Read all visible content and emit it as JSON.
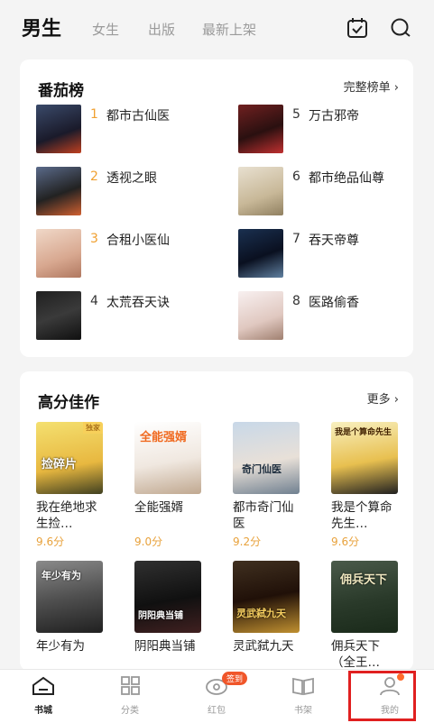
{
  "header": {
    "active_tab": "男生",
    "tabs": [
      "女生",
      "出版",
      "最新上架"
    ],
    "icons": [
      "calendar-check-icon",
      "search-icon"
    ]
  },
  "ranking": {
    "title": "番茄榜",
    "link": "完整榜单 ›",
    "items": [
      {
        "num": "1",
        "title": "都市古仙医"
      },
      {
        "num": "2",
        "title": "透视之眼"
      },
      {
        "num": "3",
        "title": "合租小医仙"
      },
      {
        "num": "4",
        "title": "太荒吞天诀"
      },
      {
        "num": "5",
        "title": "万古邪帝"
      },
      {
        "num": "6",
        "title": "都市绝品仙尊"
      },
      {
        "num": "7",
        "title": "吞天帝尊"
      },
      {
        "num": "8",
        "title": "医路偷香"
      }
    ],
    "top_num_color": "#f0a030",
    "num_color": "#333333"
  },
  "high_score": {
    "title": "高分佳作",
    "link": "更多 ›",
    "books": [
      {
        "title": "我在绝地求生捡…",
        "score": "9.6分",
        "cover_text": "捡碎片",
        "badge": "独家"
      },
      {
        "title": "全能强婿",
        "score": "9.0分",
        "cover_text": "全能强婿",
        "badge": ""
      },
      {
        "title": "都市奇门仙医",
        "score": "9.2分",
        "cover_text": "奇门仙医",
        "badge": ""
      },
      {
        "title": "我是个算命先生…",
        "score": "9.6分",
        "cover_text": "我是个算命先生",
        "badge": ""
      },
      {
        "title": "年少有为",
        "score": "",
        "cover_text": "年少有为",
        "badge": ""
      },
      {
        "title": "阴阳典当铺",
        "score": "",
        "cover_text": "阴阳典当铺",
        "badge": ""
      },
      {
        "title": "灵武弑九天",
        "score": "",
        "cover_text": "灵武弑九天",
        "badge": ""
      },
      {
        "title": "佣兵天下（全王…",
        "score": "",
        "cover_text": "佣兵天下",
        "badge": ""
      }
    ]
  },
  "bottom_nav": {
    "items": [
      {
        "label": "书城",
        "icon": "bookstore-icon"
      },
      {
        "label": "分类",
        "icon": "category-icon"
      },
      {
        "label": "红包",
        "icon": "red-packet-icon"
      },
      {
        "label": "书架",
        "icon": "bookshelf-icon"
      },
      {
        "label": "我的",
        "icon": "profile-icon"
      }
    ],
    "sign_badge": "签到"
  }
}
